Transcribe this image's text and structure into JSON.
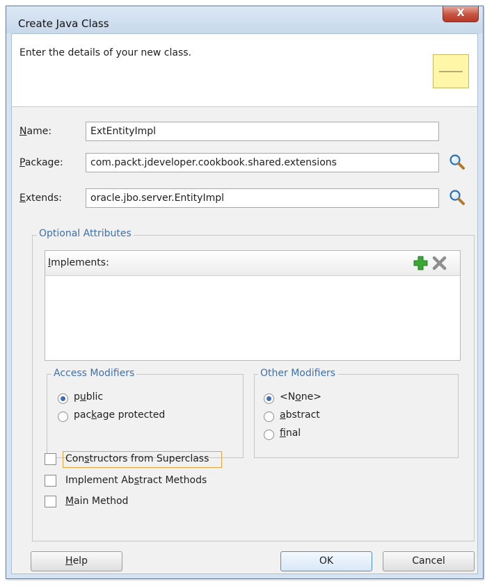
{
  "window": {
    "title": "Create Java Class",
    "close_label": "X"
  },
  "header": {
    "text": "Enter the details of your new class."
  },
  "form": {
    "name": {
      "label_mnemonic": "N",
      "label_rest": "ame:",
      "value": "ExtEntityImpl"
    },
    "package": {
      "label_mnemonic": "P",
      "label_rest": "ackage:",
      "value": "com.packt.jdeveloper.cookbook.shared.extensions"
    },
    "extends": {
      "label_mnemonic": "E",
      "label_rest": "xtends:",
      "value": "oracle.jbo.server.EntityImpl"
    }
  },
  "optional": {
    "title": "Optional Attributes",
    "implements": {
      "label_mnemonic": "I",
      "label_rest": "mplements:"
    },
    "access": {
      "title": "Access Modifiers",
      "options": [
        {
          "pre": "p",
          "mn": "u",
          "post": "blic",
          "checked": true
        },
        {
          "pre": "pac",
          "mn": "k",
          "post": "age protected",
          "checked": false
        }
      ]
    },
    "other": {
      "title": "Other Modifiers",
      "options": [
        {
          "pre": "<N",
          "mn": "o",
          "post": "ne>",
          "checked": true
        },
        {
          "pre": "",
          "mn": "a",
          "post": "bstract",
          "checked": false
        },
        {
          "pre": "",
          "mn": "f",
          "post": "inal",
          "checked": false
        }
      ]
    },
    "checkboxes": [
      {
        "pre": "Con",
        "mn": "s",
        "post": "tructors from Superclass",
        "checked": false
      },
      {
        "pre": "Implement Ab",
        "mn": "s",
        "post": "tract Methods",
        "checked": false
      },
      {
        "pre": "",
        "mn": "M",
        "post": "ain Method",
        "checked": false
      }
    ]
  },
  "buttons": {
    "help": {
      "mn": "H",
      "post": "elp"
    },
    "ok": "OK",
    "cancel": "Cancel"
  },
  "colors": {
    "accent": "#3c70b2",
    "add_icon": "#3aa832",
    "focus": "#e8a33b"
  }
}
